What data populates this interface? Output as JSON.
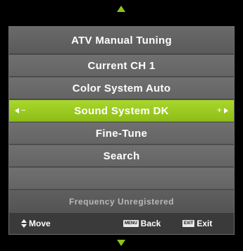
{
  "menu": {
    "title": "ATV Manual Tuning",
    "items": [
      {
        "label": "Current CH 1"
      },
      {
        "label": "Color System Auto"
      },
      {
        "label": "Sound System DK",
        "selected": true,
        "left_symbol": "−",
        "right_symbol": "+"
      },
      {
        "label": "Fine-Tune"
      },
      {
        "label": "Search"
      },
      {
        "label": ""
      }
    ],
    "status": "Frequency Unregistered"
  },
  "footer": {
    "move_label": "Move",
    "menu_key": "MENU",
    "back_label": "Back",
    "exit_key": "EXIT",
    "exit_label": "Exit"
  },
  "colors": {
    "accent": "#8cc21f",
    "panel": "#555555",
    "item": "#6a6a6a",
    "footer": "#3a3a3a"
  },
  "icons": {
    "scroll_up": "triangle-up-icon",
    "scroll_down": "triangle-down-icon",
    "move": "up-down-arrows-icon"
  }
}
